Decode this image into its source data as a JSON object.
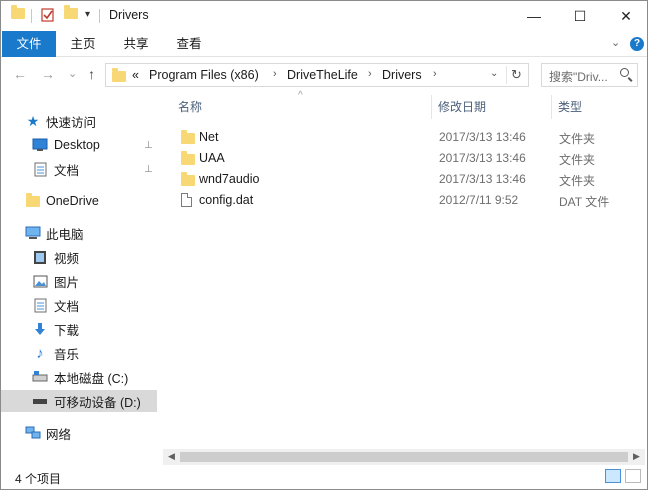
{
  "window": {
    "title": "Drivers",
    "minimize_glyph": "—",
    "maximize_glyph": "☐",
    "close_glyph": "✕"
  },
  "ribbon": {
    "tabs": [
      "文件",
      "主页",
      "共享",
      "查看"
    ],
    "expand_glyph": "⌄",
    "help_glyph": "?"
  },
  "address": {
    "back_glyph": "←",
    "forward_glyph": "→",
    "recent_glyph": "⌄",
    "up_glyph": "↑",
    "overflow": "«",
    "crumbs": [
      "Program Files (x86)",
      "DriveTheLife",
      "Drivers"
    ],
    "crumb_sep": "›",
    "dropdown_glyph": "⌄",
    "refresh_glyph": "↻"
  },
  "search": {
    "placeholder": "搜索\"Driv..."
  },
  "nav": {
    "quick_access": "快速访问",
    "desktop": "Desktop",
    "documents_pinned": "文档",
    "onedrive": "OneDrive",
    "this_pc": "此电脑",
    "videos": "视频",
    "pictures": "图片",
    "documents": "文档",
    "downloads": "下载",
    "music": "音乐",
    "local_disk": "本地磁盘 (C:)",
    "removable": "可移动设备 (D:)",
    "network": "网络",
    "pin_glyph": "📌"
  },
  "columns": {
    "name": "名称",
    "date": "修改日期",
    "type": "类型",
    "sort_glyph": "^"
  },
  "files": [
    {
      "name": "Net",
      "date": "2017/3/13 13:46",
      "type": "文件夹",
      "icon": "folder-icon"
    },
    {
      "name": "UAA",
      "date": "2017/3/13 13:46",
      "type": "文件夹",
      "icon": "folder-icon"
    },
    {
      "name": "wnd7audio",
      "date": "2017/3/13 13:46",
      "type": "文件夹",
      "icon": "folder-icon"
    },
    {
      "name": "config.dat",
      "date": "2012/7/11 9:52",
      "type": "DAT 文件",
      "icon": "file-icon"
    }
  ],
  "status": {
    "item_count": "4 个项目"
  },
  "colors": {
    "accent": "#1979ca",
    "folder": "#f8d775",
    "selected_bg": "#cce8ff"
  }
}
